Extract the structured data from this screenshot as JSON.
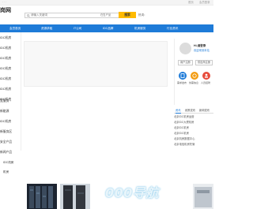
{
  "topbar": {
    "left_text": "· · ·",
    "links": [
      "首页",
      "会员登录"
    ]
  },
  "header": {
    "logo_text": "岗网",
    "search": {
      "placeholder": "请输入关键词",
      "scope": "在售产品",
      "button_label": "搜索"
    },
    "right_link": "热词："
  },
  "nav": {
    "items": [
      "会员首页",
      "资源求租",
      "IT公司",
      "IDC品牌",
      "机房服务",
      "行业资讯"
    ]
  },
  "category": {
    "items": [
      "IDC机房",
      "IDC机房",
      "IDC机房",
      "IDC机房",
      "IDC机房",
      "IDC机房",
      "IDC机房",
      "宽服务 ›",
      "新能源",
      "IDC机房",
      "新服务区",
      "安全产品",
      "新闻产品"
    ]
  },
  "user_card": {
    "greeting": "Hi,请登录",
    "welcome": "欢迎来到本站",
    "buttons": [
      "用户注册",
      "供应商注册"
    ],
    "quick_links": [
      {
        "label": "需求发布",
        "color": "#1e7bd8"
      },
      {
        "label": "供需信息",
        "color": "#f39c12"
      },
      {
        "label": "人员招聘",
        "color": "#e74c3c"
      }
    ]
  },
  "news_tabs": {
    "tabs": [
      "资讯",
      "政策发布",
      "新闻发布"
    ],
    "active": 0,
    "items": [
      "北京IDC机房运营",
      "北京IDC大厦机房",
      "北京IDC机房",
      "北京IDC机房",
      "北京机房数据中心",
      "北京电信机房托管"
    ]
  },
  "section": {
    "title": "IDC机房",
    "title_2": "机房"
  },
  "watermark": {
    "text": "000导航"
  }
}
